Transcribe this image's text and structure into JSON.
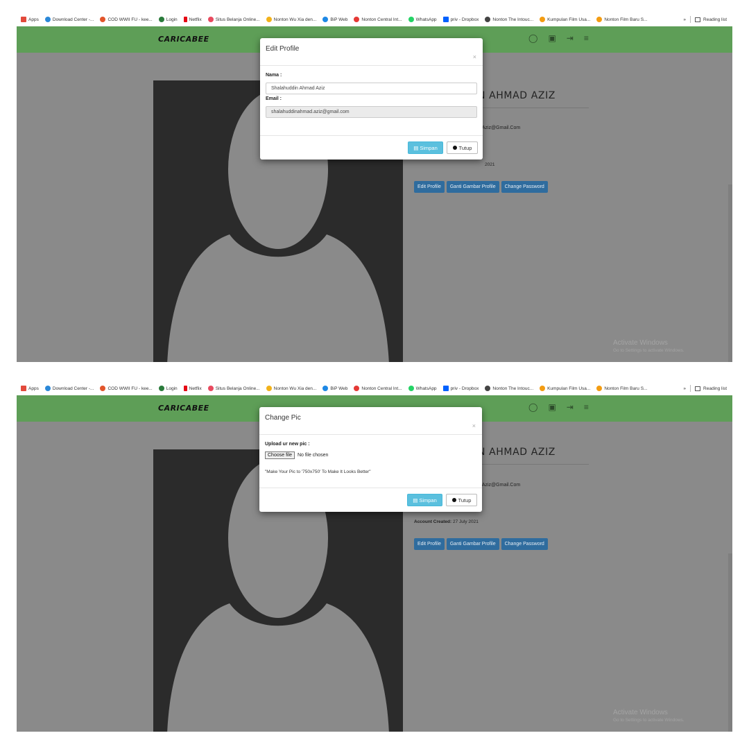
{
  "bookmarks": [
    {
      "label": "Apps",
      "color": "#e24a3b"
    },
    {
      "label": "Download Center -...",
      "color": "#2b88d8"
    },
    {
      "label": "COD WWII FU - kee...",
      "color": "#e2552b"
    },
    {
      "label": "Login",
      "color": "#2a7b3b"
    },
    {
      "label": "Netflix",
      "color": "#e50914"
    },
    {
      "label": "Situs Belanja Online...",
      "color": "#e84a5f"
    },
    {
      "label": "Nonton Wu Xia den...",
      "color": "#f2b21a"
    },
    {
      "label": "BiP Web",
      "color": "#1e88e5"
    },
    {
      "label": "Nonton Central Int...",
      "color": "#e53935"
    },
    {
      "label": "WhatsApp",
      "color": "#25d366"
    },
    {
      "label": "priv - Dropbox",
      "color": "#0061fe"
    },
    {
      "label": "Nonton The Intouc...",
      "color": "#444444"
    },
    {
      "label": "Kumpulan Film Usa...",
      "color": "#f39c12"
    },
    {
      "label": "Nonton Film Baru S...",
      "color": "#f39c12"
    }
  ],
  "bookmarks_more": "»",
  "reading_list": "Reading list",
  "brand": "CARICABEE",
  "nav_icons": [
    "user-icon",
    "cart-icon",
    "logout-icon",
    "menu-icon"
  ],
  "colors": {
    "navbar": "#5e9e57",
    "overlay": "#8a8a8a",
    "button_primary": "#2f6c9e",
    "button_save": "#5bc0de"
  },
  "profile": {
    "name_partial": "N AHMAD AZIZ",
    "email_partial": "d.Aziz@Gmail.Com",
    "account_created_label": "Account Created:",
    "account_created_value": "27 July 2021",
    "date_partial": "2021",
    "buttons": [
      "Edit Profile",
      "Ganti Gambar Profile",
      "Change Password"
    ]
  },
  "watermark": {
    "title": "Activate Windows",
    "subtitle": "Go to Settings to activate Windows."
  },
  "edit_modal": {
    "title": "Edit Profile",
    "close": "×",
    "name_label": "Nama :",
    "name_value": "Shalahuddin Ahmad Aziz",
    "email_label": "Email :",
    "email_value": "shalahuddinahmad.aziz@gmail.com",
    "save_label": "Simpan",
    "close_label": "Tutup"
  },
  "pic_modal": {
    "title": "Change Pic",
    "close": "×",
    "upload_label": "Upload ur new pic :",
    "choose_file_label": "Choose file",
    "no_file_label": "No file chosen",
    "hint": "\"Make Your Pic to '750x750' To Make It Looks Better\"",
    "save_label": "Simpan",
    "close_label": "Tutup"
  }
}
